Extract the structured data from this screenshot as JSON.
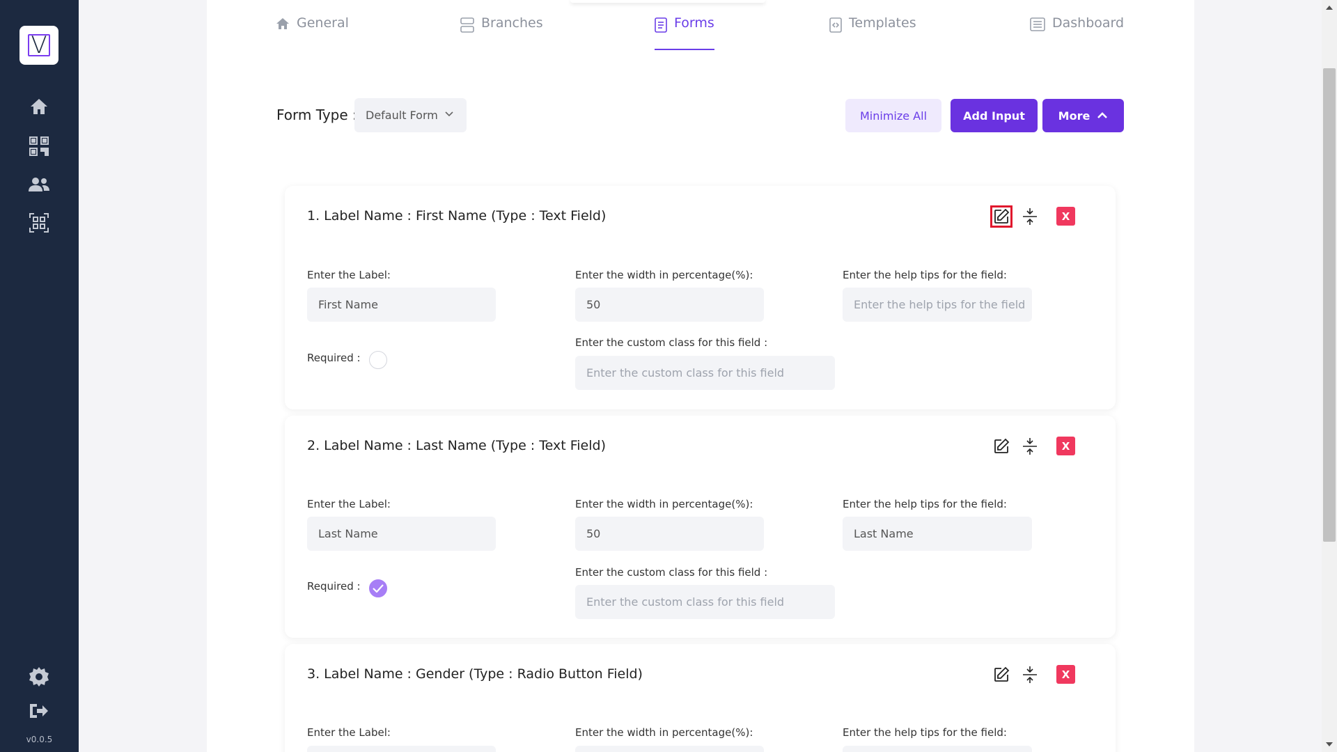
{
  "app": {
    "version": "v0.0.5",
    "logo_letter": "V"
  },
  "sidebar": {
    "items": [
      {
        "icon": "home-icon"
      },
      {
        "icon": "qr-code-icon"
      },
      {
        "icon": "users-icon"
      },
      {
        "icon": "qr-scan-icon"
      }
    ],
    "bottom": [
      {
        "icon": "gear-icon"
      },
      {
        "icon": "logout-icon"
      }
    ]
  },
  "tabs": [
    {
      "label": "General",
      "icon": "home-icon",
      "active": false
    },
    {
      "label": "Branches",
      "icon": "branches-icon",
      "active": false
    },
    {
      "label": "Forms",
      "icon": "document-icon",
      "active": true
    },
    {
      "label": "Templates",
      "icon": "template-icon",
      "active": false
    },
    {
      "label": "Dashboard",
      "icon": "dashboard-icon",
      "active": false
    }
  ],
  "toolbar": {
    "form_type_label": "Form Type :",
    "form_type_value": "Default Form",
    "minimize_all_label": "Minimize All",
    "add_input_label": "Add Input",
    "more_label": "More"
  },
  "fields": [
    {
      "title": "1. Label Name : First Name (Type : Text Field)",
      "label_caption": "Enter the Label:",
      "label_value": "First Name",
      "width_caption": "Enter the width in percentage(%):",
      "width_value": "50",
      "help_caption": "Enter the help tips for the field:",
      "help_value": "",
      "help_placeholder": "Enter the help tips for the field",
      "required_caption": "Required :",
      "required": false,
      "class_caption": "Enter the custom class for this field :",
      "class_placeholder": "Enter the custom class for this field",
      "delete_label": "X",
      "edit_highlighted": true
    },
    {
      "title": "2. Label Name : Last Name (Type : Text Field)",
      "label_caption": "Enter the Label:",
      "label_value": "Last Name",
      "width_caption": "Enter the width in percentage(%):",
      "width_value": "50",
      "help_caption": "Enter the help tips for the field:",
      "help_value": "Last Name",
      "help_placeholder": "",
      "required_caption": "Required :",
      "required": true,
      "class_caption": "Enter the custom class for this field :",
      "class_placeholder": "Enter the custom class for this field",
      "delete_label": "X",
      "edit_highlighted": false
    },
    {
      "title": "3. Label Name : Gender (Type : Radio Button Field)",
      "label_caption": "Enter the Label:",
      "width_caption": "Enter the width in percentage(%):",
      "help_caption": "Enter the help tips for the field:",
      "delete_label": "X",
      "edit_highlighted": false
    }
  ],
  "colors": {
    "sidebar_bg": "#1c2940",
    "accent": "#6a32e0",
    "delete": "#f0385e",
    "highlight": "#e0182d"
  }
}
